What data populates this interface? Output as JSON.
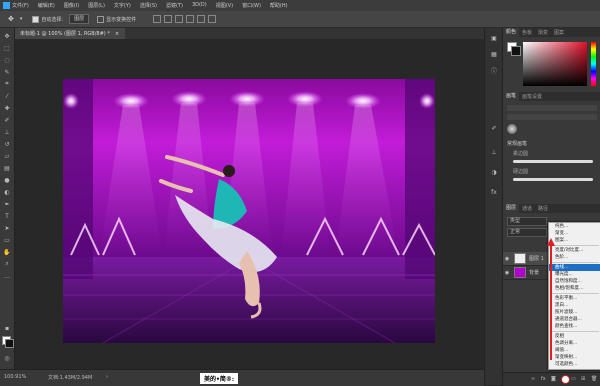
{
  "menubar": {
    "app_icon": "photoshop-logo",
    "items": [
      "文件(F)",
      "编辑(E)",
      "图像(I)",
      "图层(L)",
      "文字(Y)",
      "选择(S)",
      "滤镜(T)",
      "3D(D)",
      "视图(V)",
      "窗口(W)",
      "帮助(H)"
    ]
  },
  "options": {
    "auto_select_label": "自动选择:",
    "auto_select_value": "图层",
    "show_transform_label": "显示变换控件"
  },
  "document": {
    "tab_label": "未标题-1 @ 100% (图层 1, RGB/8#) *"
  },
  "status": {
    "zoom": "100.91%",
    "doc_info": "文档:1.43M/2.94M"
  },
  "panels": {
    "color_tabs": [
      "颜色",
      "色板",
      "渐变",
      "图案"
    ],
    "brush_tabs": [
      "画笔",
      "画笔设置"
    ],
    "brush_group": "常规画笔",
    "brush_items": [
      "柔边圆",
      "硬边圆"
    ],
    "layers_tabs": [
      "图层",
      "通道",
      "路径"
    ],
    "kind_label": "类型",
    "blend_label": "正常",
    "layers": [
      {
        "name": "图层 1"
      },
      {
        "name": "背景"
      }
    ]
  },
  "context_menu": {
    "items": [
      "纯色...",
      "渐变...",
      "图案...",
      "亮度/对比度...",
      "色阶...",
      "曲线...",
      "曝光度...",
      "自然饱和度...",
      "色相/饱和度...",
      "色彩平衡...",
      "黑白...",
      "照片滤镜...",
      "通道混合器...",
      "颜色查找...",
      "反相",
      "色调分离...",
      "阈值...",
      "渐变映射...",
      "可选颜色..."
    ],
    "selected": "曲线..."
  },
  "watermark": {
    "text": "美的•简®:"
  },
  "colors": {
    "accent": "#1d6fc4",
    "stage_purple": "#b000d0",
    "dress_teal": "#1fb6b6"
  }
}
